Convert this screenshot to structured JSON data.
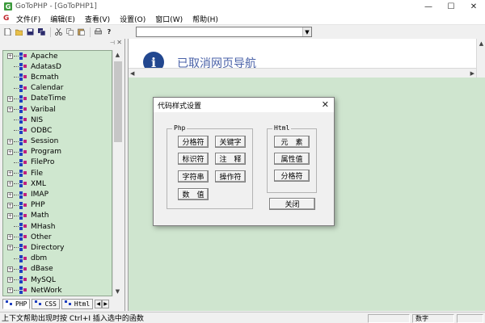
{
  "window": {
    "title": "GoToPHP - [GoToPHP1]",
    "controls": [
      "—",
      "☐",
      "✕"
    ]
  },
  "menu": {
    "items": [
      "文件(F)",
      "编辑(E)",
      "查看(V)",
      "设置(O)",
      "窗口(W)",
      "帮助(H)"
    ]
  },
  "toolbar": {
    "icons": [
      "new-icon",
      "open-icon",
      "save-icon",
      "save-all-icon",
      "cut-icon",
      "copy-icon",
      "paste-icon",
      "print-icon",
      "help-icon"
    ],
    "combo_value": ""
  },
  "tree": {
    "items": [
      "Apache",
      "AdatasD",
      "Bcmath",
      "Calendar",
      "DateTime",
      "Varibal",
      "NIS",
      "ODBC",
      "Session",
      "Program",
      "FilePro",
      "File",
      "XML",
      "IMAP",
      "PHP",
      "Math",
      "MHash",
      "Other",
      "Directory",
      "dbm",
      "dBase",
      "MySQL",
      "NetWork"
    ],
    "expandable": [
      true,
      false,
      false,
      false,
      true,
      true,
      false,
      false,
      true,
      true,
      false,
      true,
      true,
      true,
      true,
      true,
      false,
      true,
      true,
      false,
      true,
      true,
      true
    ]
  },
  "tabs": [
    "PHP",
    "CSS",
    "Html"
  ],
  "browser": {
    "message": "已取消网页导航"
  },
  "dialog": {
    "title": "代码样式设置",
    "php_group": {
      "label": "Php",
      "buttons": [
        "分格符",
        "关键字",
        "标识符",
        "注　释",
        "字符串",
        "操作符",
        "数　值"
      ]
    },
    "html_group": {
      "label": "Html",
      "buttons": [
        "元　素",
        "属性值",
        "分格符"
      ]
    },
    "close_label": "关闭"
  },
  "statusbar": {
    "text": "上下文帮助出现时按 Ctrl+I 插入选中的函数",
    "mode": "数字"
  },
  "colors": {
    "panel_bg": "#cfe7cf",
    "info_icon": "#22478f",
    "nav_text": "#4a62a8"
  }
}
